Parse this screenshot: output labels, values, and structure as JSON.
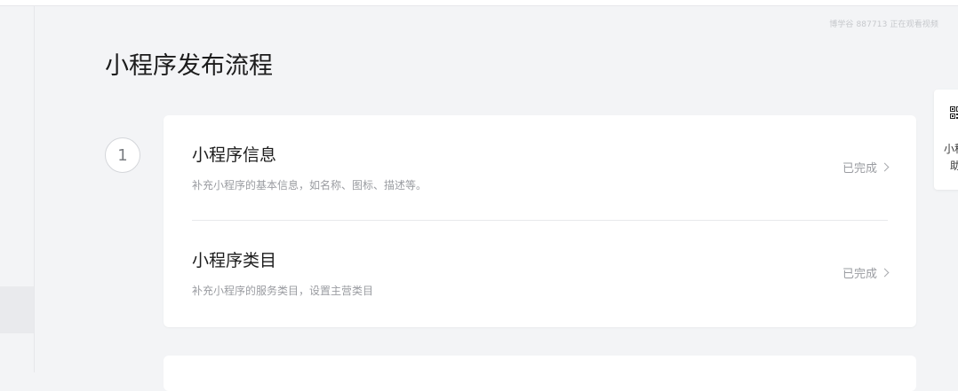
{
  "header": {
    "watermark": "博学谷 887713 正在观看视频"
  },
  "page": {
    "title": "小程序发布流程"
  },
  "steps": [
    {
      "number": "1",
      "items": [
        {
          "title": "小程序信息",
          "description": "补充小程序的基本信息，如名称、图标、描述等。",
          "status": "已完成"
        },
        {
          "title": "小程序类目",
          "description": "补充小程序的服务类目，设置主营类目",
          "status": "已完成"
        }
      ]
    }
  ],
  "side_widget": {
    "icon": "qr-code-icon",
    "line1": "小程",
    "line2": "助"
  },
  "colors": {
    "background": "#f3f4f6",
    "card": "#ffffff",
    "muted_text": "#9a9ca1"
  }
}
